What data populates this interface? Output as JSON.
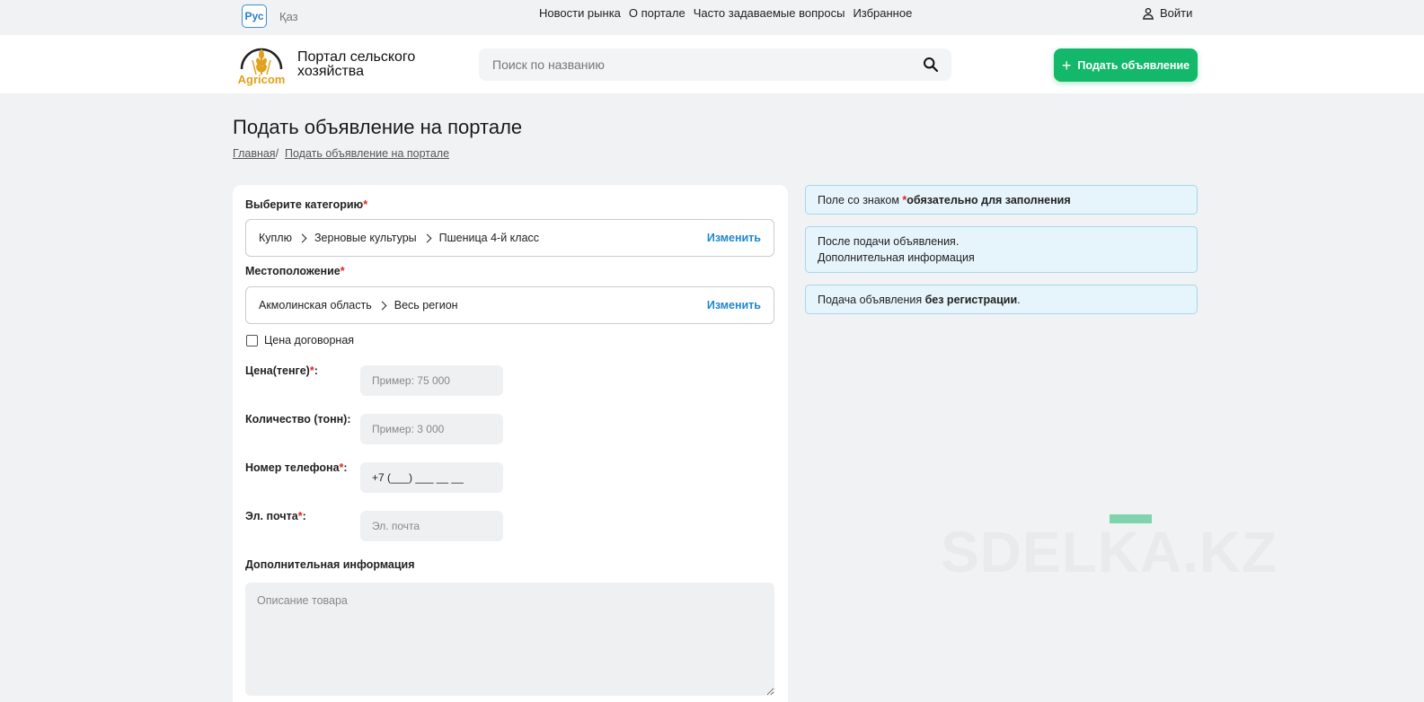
{
  "topbar": {
    "lang_active": "Рус",
    "lang_other": "Қаз",
    "nav": [
      "Новости рынка",
      "О портале",
      "Часто задаваемые вопросы",
      "Избранное"
    ],
    "login": "Войти"
  },
  "header": {
    "logo_text": "Agricom",
    "brand_line1": "Портал сельского",
    "brand_line2": "хозяйства",
    "search_placeholder": "Поиск по названию",
    "post_button": "Подать объявление"
  },
  "page": {
    "title": "Подать объявление на портале",
    "breadcrumb_home": "Главная",
    "breadcrumb_sep": "/",
    "breadcrumb_current": "Подать объявление на портале"
  },
  "form": {
    "category_label": "Выберите категорию",
    "category_path": [
      "Куплю",
      "Зерновые культуры",
      "Пшеница 4-й класс"
    ],
    "change_label": "Изменить",
    "location_label": "Местоположение",
    "location_path": [
      "Акмолинская область",
      "Весь регион"
    ],
    "negotiable_label": "Цена договорная",
    "price_label": "Цена(тенге)",
    "price_placeholder": "Пример: 75 000",
    "quantity_label": "Количество (тонн):",
    "quantity_placeholder": "Пример: 3 000",
    "phone_label": "Номер телефона",
    "phone_placeholder": "+7 (___) ___ __ __",
    "email_label": "Эл. почта",
    "email_placeholder": "Эл. почта",
    "extra_label": "Дополнительная информация",
    "extra_placeholder": "Описание товара",
    "required_mark": "*",
    "colon": ":"
  },
  "info": {
    "box1_text": "Поле со знаком ",
    "box1_bold": "обязательно для заполнения",
    "box2_line1": "После подачи объявления.",
    "box2_line2": "Дополнительная информация",
    "box3_text": "Подача объявления ",
    "box3_bold": "без регистрации",
    "box3_end": "."
  },
  "watermark": "SDELKA.KZ",
  "colors": {
    "accent_green": "#14b86a",
    "link_blue": "#1e88d2",
    "required_red": "#e02424"
  }
}
